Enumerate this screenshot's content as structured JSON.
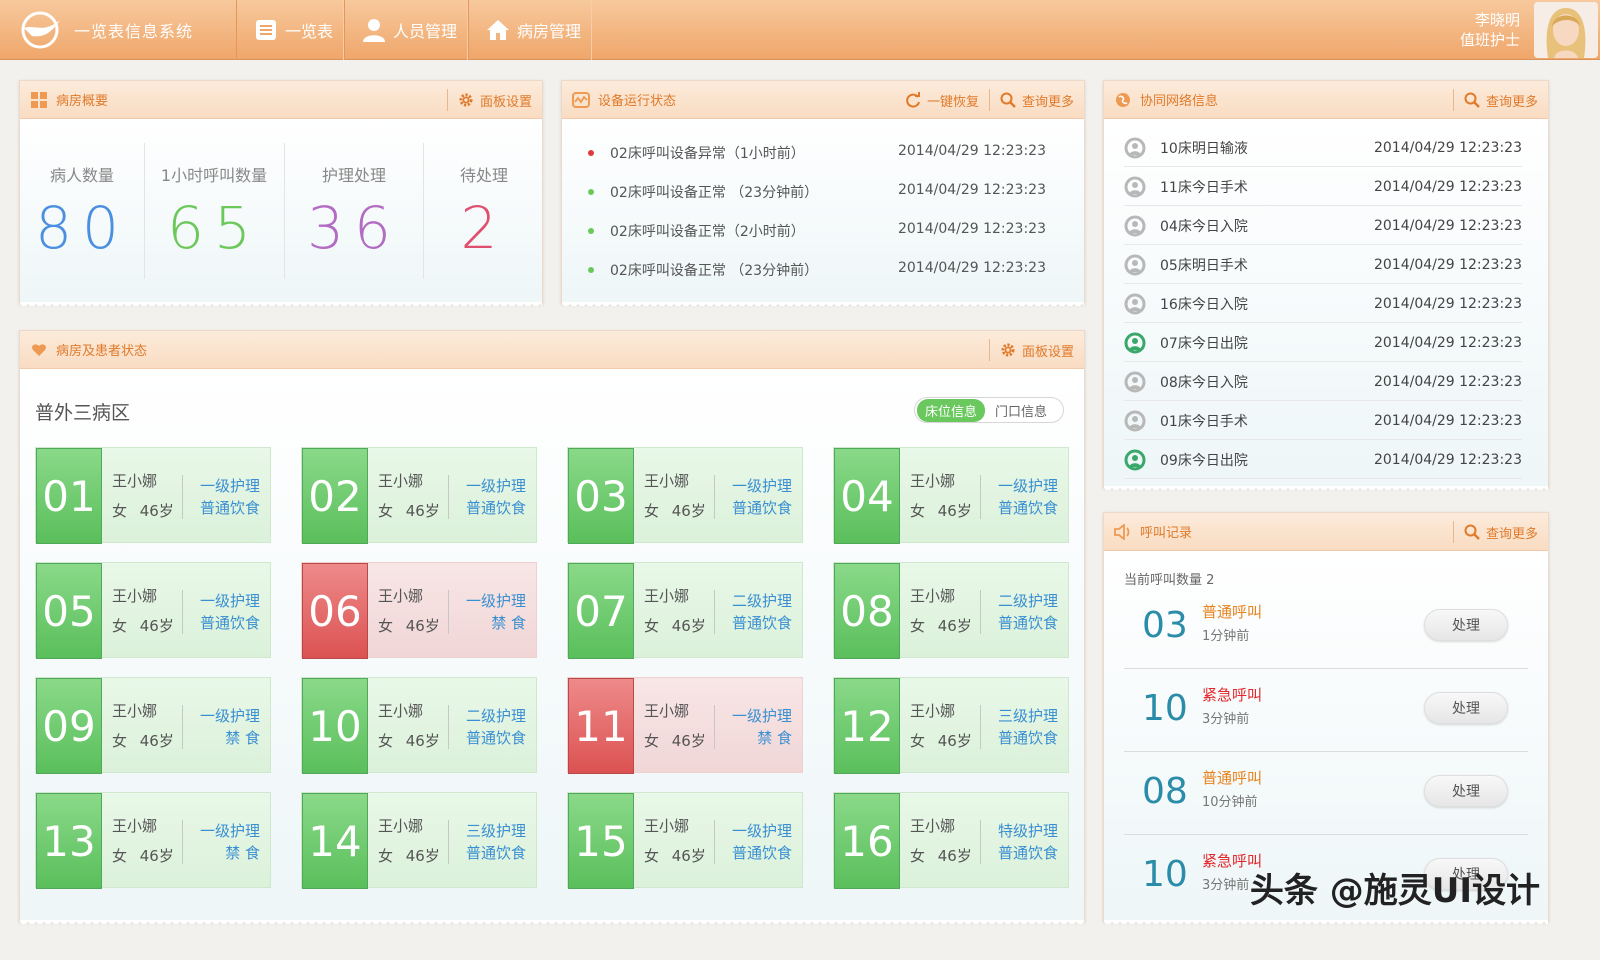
{
  "app": {
    "title": "一览表信息系统"
  },
  "nav": [
    {
      "label": "一览表",
      "icon": "list-icon"
    },
    {
      "label": "人员管理",
      "icon": "person-icon"
    },
    {
      "label": "病房管理",
      "icon": "home-icon"
    }
  ],
  "user": {
    "name": "李晓明",
    "role": "值班护士"
  },
  "overview": {
    "title": "病房概要",
    "settings_label": "面板设置",
    "stats": [
      {
        "label": "病人数量",
        "value": "80",
        "color": "#4a8fe0"
      },
      {
        "label": "1小时呼叫数量",
        "value": "65",
        "color": "#6cc85a"
      },
      {
        "label": "护理处理",
        "value": "36",
        "color": "#b36cc4"
      },
      {
        "label": "待处理",
        "value": "2",
        "color": "#e0506e"
      }
    ]
  },
  "device": {
    "title": "设备运行状态",
    "restore_label": "一键恢复",
    "more_label": "查询更多",
    "rows": [
      {
        "text": "02床呼叫设备异常（1小时前）",
        "time": "2014/04/29 12:23:23",
        "status_color": "#e23a3a"
      },
      {
        "text": "02床呼叫设备正常 （23分钟前）",
        "time": "2014/04/29 12:23:23",
        "status_color": "#6cc85a"
      },
      {
        "text": "02床呼叫设备正常（2小时前）",
        "time": "2014/04/29 12:23:23",
        "status_color": "#6cc85a"
      },
      {
        "text": "02床呼叫设备正常 （23分钟前）",
        "time": "2014/04/29 12:23:23",
        "status_color": "#6cc85a"
      }
    ]
  },
  "network": {
    "title": "协同网络信息",
    "more_label": "查询更多",
    "rows": [
      {
        "text": "10床明日输液",
        "time": "2014/04/29 12:23:23",
        "icon_color": "#b8b8b8"
      },
      {
        "text": "11床今日手术",
        "time": "2014/04/29 12:23:23",
        "icon_color": "#b8b8b8"
      },
      {
        "text": "04床今日入院",
        "time": "2014/04/29 12:23:23",
        "icon_color": "#b8b8b8"
      },
      {
        "text": "05床明日手术",
        "time": "2014/04/29 12:23:23",
        "icon_color": "#b8b8b8"
      },
      {
        "text": "16床今日入院",
        "time": "2014/04/29 12:23:23",
        "icon_color": "#b8b8b8"
      },
      {
        "text": "07床今日出院",
        "time": "2014/04/29 12:23:23",
        "icon_color": "#3aa86a"
      },
      {
        "text": "08床今日入院",
        "time": "2014/04/29 12:23:23",
        "icon_color": "#b8b8b8"
      },
      {
        "text": "01床今日手术",
        "time": "2014/04/29 12:23:23",
        "icon_color": "#b8b8b8"
      },
      {
        "text": "09床今日出院",
        "time": "2014/04/29 12:23:23",
        "icon_color": "#3aa86a"
      }
    ]
  },
  "ward": {
    "title": "病房及患者状态",
    "settings_label": "面板设置",
    "area_name": "普外三病区",
    "toggle_on": "床位信息",
    "toggle_off": "门口信息",
    "beds": [
      {
        "num": "01",
        "name": "王小娜",
        "info": "女 46岁",
        "care": "一级护理",
        "diet": "普通饮食",
        "status": "green"
      },
      {
        "num": "02",
        "name": "王小娜",
        "info": "女 46岁",
        "care": "一级护理",
        "diet": "普通饮食",
        "status": "green"
      },
      {
        "num": "03",
        "name": "王小娜",
        "info": "女 46岁",
        "care": "一级护理",
        "diet": "普通饮食",
        "status": "green"
      },
      {
        "num": "04",
        "name": "王小娜",
        "info": "女 46岁",
        "care": "一级护理",
        "diet": "普通饮食",
        "status": "green"
      },
      {
        "num": "05",
        "name": "王小娜",
        "info": "女 46岁",
        "care": "一级护理",
        "diet": "普通饮食",
        "status": "green"
      },
      {
        "num": "06",
        "name": "王小娜",
        "info": "女 46岁",
        "care": "一级护理",
        "diet": "禁 食",
        "status": "red"
      },
      {
        "num": "07",
        "name": "王小娜",
        "info": "女 46岁",
        "care": "二级护理",
        "diet": "普通饮食",
        "status": "green"
      },
      {
        "num": "08",
        "name": "王小娜",
        "info": "女 46岁",
        "care": "二级护理",
        "diet": "普通饮食",
        "status": "green"
      },
      {
        "num": "09",
        "name": "王小娜",
        "info": "女 46岁",
        "care": "一级护理",
        "diet": "禁 食",
        "status": "green"
      },
      {
        "num": "10",
        "name": "王小娜",
        "info": "女 46岁",
        "care": "二级护理",
        "diet": "普通饮食",
        "status": "green"
      },
      {
        "num": "11",
        "name": "王小娜",
        "info": "女 46岁",
        "care": "一级护理",
        "diet": "禁 食",
        "status": "red"
      },
      {
        "num": "12",
        "name": "王小娜",
        "info": "女 46岁",
        "care": "三级护理",
        "diet": "普通饮食",
        "status": "green"
      },
      {
        "num": "13",
        "name": "王小娜",
        "info": "女 46岁",
        "care": "一级护理",
        "diet": "禁 食",
        "status": "green"
      },
      {
        "num": "14",
        "name": "王小娜",
        "info": "女 46岁",
        "care": "三级护理",
        "diet": "普通饮食",
        "status": "green"
      },
      {
        "num": "15",
        "name": "王小娜",
        "info": "女 46岁",
        "care": "一级护理",
        "diet": "普通饮食",
        "status": "green"
      },
      {
        "num": "16",
        "name": "王小娜",
        "info": "女 46岁",
        "care": "特级护理",
        "diet": "普通饮食",
        "status": "green"
      }
    ]
  },
  "calls": {
    "title": "呼叫记录",
    "more_label": "查询更多",
    "count_label": "当前呼叫数量 2",
    "rows": [
      {
        "num": "03",
        "type": "普通呼叫",
        "kind": "normal",
        "ago": "1分钟前",
        "btn": "处理"
      },
      {
        "num": "10",
        "type": "紧急呼叫",
        "kind": "urgent",
        "ago": "3分钟前",
        "btn": "处理"
      },
      {
        "num": "08",
        "type": "普通呼叫",
        "kind": "normal",
        "ago": "10分钟前",
        "btn": "处理"
      },
      {
        "num": "10",
        "type": "紧急呼叫",
        "kind": "urgent",
        "ago": "3分钟前",
        "btn": "处理"
      }
    ]
  },
  "watermark": "头条 @施灵UI设计"
}
